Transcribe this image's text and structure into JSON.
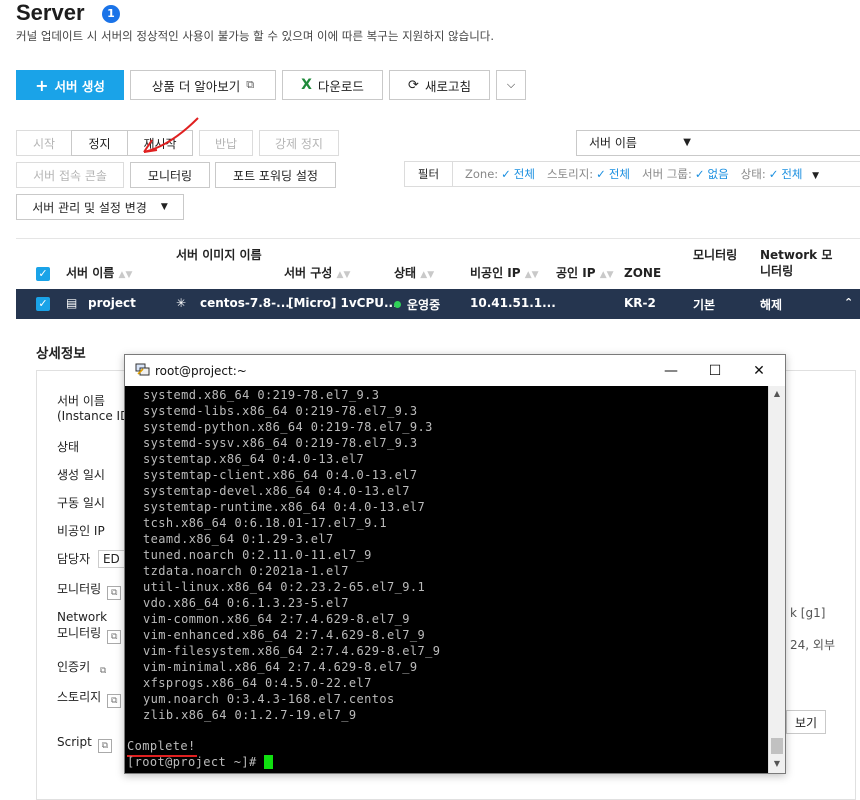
{
  "page": {
    "title": "Server",
    "count": "1",
    "subtitle": "커널 업데이트 시 서버의 정상적인 사용이 불가능 할 수 있으며 이에 따른 복구는 지원하지 않습니다."
  },
  "toolbar": {
    "create": "서버 생성",
    "learn_more": "상품 더 알아보기",
    "download": "다운로드",
    "refresh": "새로고침"
  },
  "actions": {
    "start": "시작",
    "stop": "정지",
    "restart": "재시작",
    "return": "반납",
    "force_stop": "강제 정지",
    "console": "서버 접속 콘솔",
    "monitoring": "모니터링",
    "port_forwarding": "포트 포워딩 설정",
    "manage": "서버 관리 및 설정 변경"
  },
  "search": {
    "field": "서버 이름",
    "placeholder": ""
  },
  "filters": {
    "label": "필터",
    "zone_label": "Zone:",
    "zone_value": "전체",
    "storage_label": "스토리지:",
    "storage_value": "전체",
    "group_label": "서버 그룹:",
    "group_value": "없음",
    "status_label": "상태:",
    "status_value": "전체"
  },
  "table": {
    "headers": {
      "name": "서버 이름",
      "image_line1": "서버 이미지 이름",
      "config": "서버 구성",
      "status": "상태",
      "private_ip": "비공인 IP",
      "public_ip": "공인 IP",
      "zone": "ZONE",
      "monitoring": "모니터링",
      "network_line1": "Network 모",
      "network_line2": "니터링"
    },
    "row": {
      "name": "project",
      "image": "centos-7.8-...",
      "config": "[Micro] 1vCPU...",
      "status": "운영중",
      "private_ip": "10.41.51.1...",
      "zone": "KR-2",
      "monitoring": "기본",
      "network": "해제"
    }
  },
  "detail": {
    "title": "상세정보",
    "labels": {
      "name_line1": "서버 이름",
      "name_line2": "(Instance ID)",
      "status": "상태",
      "created": "생성 일시",
      "started": "구동 일시",
      "private_ip": "비공인 IP",
      "owner": "담당자",
      "monitoring": "모니터링",
      "network_line1": "Network",
      "network_line2": "모니터링",
      "auth_key": "인증키",
      "storage": "스토리지",
      "script": "Script"
    },
    "owner_value": "ED",
    "right_fragment_1": "k [g1]",
    "right_fragment_2": "24, 외부",
    "right_button": "보기"
  },
  "terminal": {
    "title": "root@project:~",
    "lines": [
      "systemd.x86_64 0:219-78.el7_9.3",
      "systemd-libs.x86_64 0:219-78.el7_9.3",
      "systemd-python.x86_64 0:219-78.el7_9.3",
      "systemd-sysv.x86_64 0:219-78.el7_9.3",
      "systemtap.x86_64 0:4.0-13.el7",
      "systemtap-client.x86_64 0:4.0-13.el7",
      "systemtap-devel.x86_64 0:4.0-13.el7",
      "systemtap-runtime.x86_64 0:4.0-13.el7",
      "tcsh.x86_64 0:6.18.01-17.el7_9.1",
      "teamd.x86_64 0:1.29-3.el7",
      "tuned.noarch 0:2.11.0-11.el7_9",
      "tzdata.noarch 0:2021a-1.el7",
      "util-linux.x86_64 0:2.23.2-65.el7_9.1",
      "vdo.x86_64 0:6.1.3.23-5.el7",
      "vim-common.x86_64 2:7.4.629-8.el7_9",
      "vim-enhanced.x86_64 2:7.4.629-8.el7_9",
      "vim-filesystem.x86_64 2:7.4.629-8.el7_9",
      "vim-minimal.x86_64 2:7.4.629-8.el7_9",
      "xfsprogs.x86_64 0:4.5.0-22.el7",
      "yum.noarch 0:3.4.3-168.el7.centos",
      "zlib.x86_64 0:1.2.7-19.el7_9"
    ],
    "complete": "Complete!",
    "prompt": "[root@project ~]# "
  },
  "colors": {
    "primary": "#1aa3e8",
    "selected_row": "#25354f",
    "terminal_bg": "#000000",
    "terminal_text": "#bbbbbb",
    "cursor": "#10e010",
    "annotation_red": "#e02020"
  }
}
